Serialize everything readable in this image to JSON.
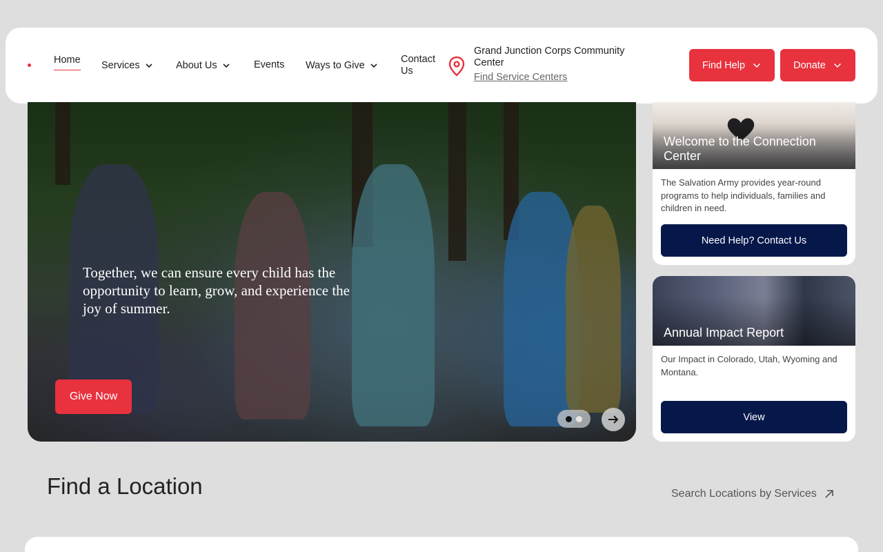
{
  "header": {
    "nav": [
      {
        "label": "Home",
        "active": true,
        "has_dropdown": false
      },
      {
        "label": "Services",
        "has_dropdown": true
      },
      {
        "label": "About Us",
        "has_dropdown": true
      },
      {
        "label": "Events",
        "has_dropdown": false
      },
      {
        "label": "Ways to Give",
        "has_dropdown": true
      },
      {
        "label": "Contact Us",
        "has_dropdown": false
      }
    ],
    "location": {
      "name": "Grand Junction Corps Community Center",
      "link": "Find Service Centers",
      "icon": "map-pin-icon"
    },
    "buttons": {
      "find_help": "Find Help",
      "donate": "Donate"
    }
  },
  "hero": {
    "text": "Together, we can ensure every child has the opportunity to learn, grow, and experience the joy of summer.",
    "cta": "Give Now",
    "slides_total": 2,
    "active_slide": 1
  },
  "cards": [
    {
      "title": "Welcome to the Connection Center",
      "description": "The Salvation Army provides year-round programs to help individuals, families and children in need.",
      "button": "Need Help? Contact Us"
    },
    {
      "title": "Annual Impact Report",
      "description": "Our Impact in Colorado, Utah, Wyoming and Montana.",
      "button": "View"
    }
  ],
  "find_location": {
    "title": "Find a Location",
    "search_link": "Search Locations by Services"
  },
  "colors": {
    "brand_red": "#e8323e",
    "navy": "#06174a",
    "page_bg": "#dedede"
  }
}
